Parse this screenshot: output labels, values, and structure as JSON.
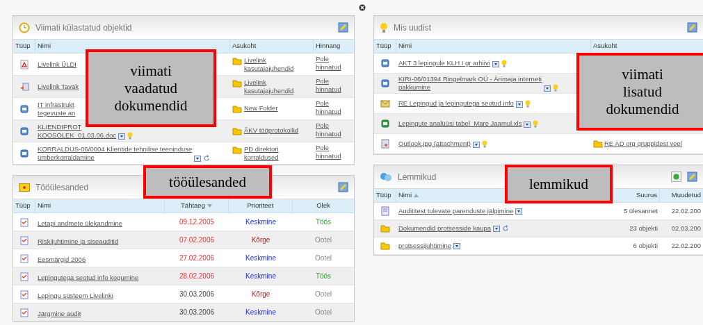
{
  "recent": {
    "title": "Viimati külastatud objektid",
    "columns": [
      "Tüüp",
      "Nimi",
      "Asukoht",
      "Hinnang"
    ],
    "callout": [
      "viimati",
      "vaadatud",
      "dokumendid"
    ],
    "rows": [
      {
        "kind": "pdf",
        "name": [
          "Livelink ÜLDI"
        ],
        "menu": false,
        "new": false,
        "refresh": false,
        "location": [
          "Livelink",
          "kasutajajuhendid"
        ],
        "rating": [
          "Pole",
          "hinnatud"
        ]
      },
      {
        "kind": "shortcut",
        "name": [
          "Livelink Tavak"
        ],
        "menu": false,
        "new": false,
        "refresh": false,
        "location": [
          "Livelink",
          "kasutajajuhendid"
        ],
        "rating": [
          "Pole",
          "hinnatud"
        ]
      },
      {
        "kind": "doc",
        "name": [
          "IT infrastrukt",
          "tegevuste an"
        ],
        "menu": false,
        "new": false,
        "refresh": false,
        "location": [
          "New Folder"
        ],
        "rating": [
          "Pole",
          "hinnatud"
        ]
      },
      {
        "kind": "doc",
        "name": [
          "KLIENDIPROT",
          "KOOSOLEK_01.03.06.doc"
        ],
        "menu": true,
        "new": true,
        "refresh": false,
        "location": [
          "ÄKV tööprotokollid"
        ],
        "rating": [
          "Pole",
          "hinnatud"
        ]
      },
      {
        "kind": "doc",
        "name": [
          "KORRALDUS-06/0004 Klientide tehnilise teeninduse",
          "ümberkorraldamine"
        ],
        "menu": true,
        "new": false,
        "refresh": true,
        "location": [
          "PD direktori",
          "korraldused"
        ],
        "rating": [
          "Pole",
          "hinnatud"
        ]
      }
    ]
  },
  "tasks": {
    "title": "Tööülesanded",
    "callout": [
      "tööülesanded"
    ],
    "columns": [
      {
        "label": "Tüüp",
        "sorted": false
      },
      {
        "label": "Nimi",
        "sorted": false
      },
      {
        "label": "Tähtaeg",
        "sorted": true
      },
      {
        "label": "Prioriteet",
        "sorted": false
      },
      {
        "label": "Olek",
        "sorted": false
      }
    ],
    "rows": [
      {
        "name": "Letapi andmete ülekandmine",
        "due": "09.12.2005",
        "overdue": true,
        "priority": "Keskmine",
        "high_priority": false,
        "status": "Töös",
        "in_progress": true
      },
      {
        "name": "Riskijuhtimine ja siseauditid",
        "due": "07.02.2006",
        "overdue": true,
        "priority": "Kõrge",
        "high_priority": true,
        "status": "Ootel",
        "in_progress": false
      },
      {
        "name": "Eesmärgid 2006",
        "due": "27.02.2006",
        "overdue": true,
        "priority": "Keskmine",
        "high_priority": false,
        "status": "Ootel",
        "in_progress": false
      },
      {
        "name": "Lepingutega seotud info kogumine",
        "due": "28.02.2006",
        "overdue": true,
        "priority": "Keskmine",
        "high_priority": false,
        "status": "Töös",
        "in_progress": true
      },
      {
        "name": "Lepingu süsteem Livelinki",
        "due": "30.03.2006",
        "overdue": false,
        "priority": "Kõrge",
        "high_priority": true,
        "status": "Ootel",
        "in_progress": false
      },
      {
        "name": "Järgmine audit",
        "due": "30.03.2006",
        "overdue": false,
        "priority": "Keskmine",
        "high_priority": false,
        "status": "Ootel",
        "in_progress": false
      }
    ]
  },
  "news": {
    "title": "Mis uudist",
    "columns": [
      "Tüüp",
      "Nimi",
      "Asukoht"
    ],
    "callout": [
      "viimati",
      "lisatud",
      "dokumendid"
    ],
    "rows": [
      {
        "kind": "doc",
        "name": [
          "AKT 3 lepingule KLH I gr arhiivi"
        ],
        "menu": true,
        "new": true,
        "refresh": false
      },
      {
        "kind": "doc",
        "name": [
          "KIRI-06/01394 Ringelmark OÜ - Ärimaja interneti",
          "pakkumine"
        ],
        "menu": true,
        "new": true,
        "refresh": false
      },
      {
        "kind": "mail",
        "name": [
          "RE Lepingud ja lepingutega seotud info"
        ],
        "menu": true,
        "new": true,
        "refresh": false
      },
      {
        "kind": "xls",
        "name": [
          "Lepingute analüüsi tabel_Mare Jaamul.xls"
        ],
        "menu": true,
        "new": true,
        "refresh": false
      },
      {
        "kind": "image",
        "name": [
          "Outlook.jpg (attachment)"
        ],
        "menu": true,
        "new": true,
        "refresh": false,
        "location": "RE AD org gruppidest veel"
      }
    ]
  },
  "favorites": {
    "title": "Lemmikud",
    "callout": [
      "lemmikud"
    ],
    "columns": [
      {
        "label": "Tüüp",
        "sorted": false
      },
      {
        "label": "Nimi",
        "sorted": true
      },
      {
        "label": "Suurus",
        "sorted": false
      },
      {
        "label": "Muudetud",
        "sorted": false
      }
    ],
    "rows": [
      {
        "kind": "tasklist",
        "name": "Audititest tulevate parenduste jälgimine",
        "menu": true,
        "new": false,
        "refresh": false,
        "size": "5 ülesannet",
        "modified": "22.02.200"
      },
      {
        "kind": "folder",
        "name": "Dokumendid protsesside kaupa",
        "menu": true,
        "new": false,
        "refresh": true,
        "size": "23 objekti",
        "modified": "02.03.200"
      },
      {
        "kind": "folder",
        "name": "protsessijuhtimine",
        "menu": true,
        "new": false,
        "refresh": false,
        "size": "6 objekti",
        "modified": "22.02.200"
      }
    ]
  }
}
